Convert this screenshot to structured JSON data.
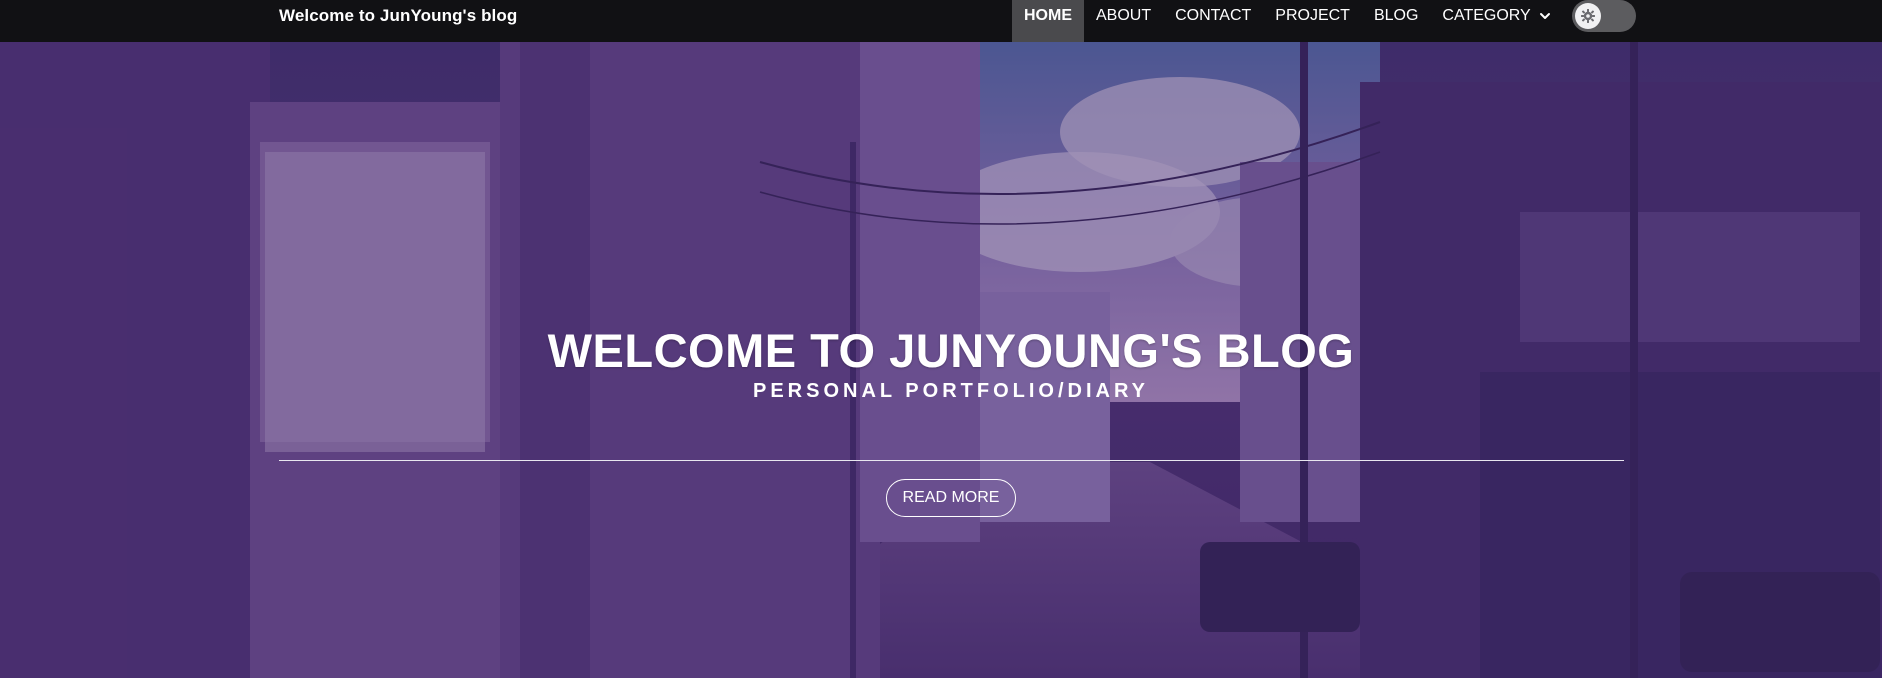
{
  "navbar": {
    "brand": "Welcome to JunYoung's blog",
    "items": [
      {
        "label": "HOME",
        "active": true
      },
      {
        "label": "ABOUT",
        "active": false
      },
      {
        "label": "CONTACT",
        "active": false
      },
      {
        "label": "PROJECT",
        "active": false
      },
      {
        "label": "BLOG",
        "active": false
      },
      {
        "label": "CATEGORY",
        "active": false,
        "has_dropdown": true
      }
    ],
    "theme_toggle": {
      "icon": "gear-icon",
      "state": "off"
    }
  },
  "hero": {
    "title": "WELCOME TO JUNYOUNG'S BLOG",
    "subtitle": "PERSONAL PORTFOLIO/DIARY",
    "button_label": "READ MORE",
    "background": "anime-style street scene with purple tint"
  },
  "colors": {
    "navbar_bg": "#111114",
    "active_tab_bg": "#4a4a4d",
    "hero_tint": "#4b3a78",
    "text": "#ffffff"
  }
}
